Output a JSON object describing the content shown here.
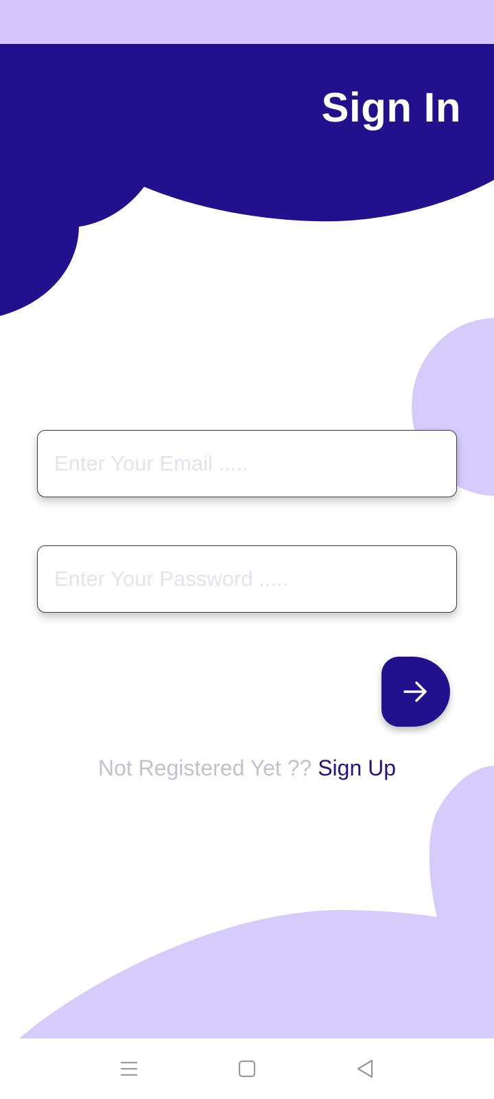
{
  "header": {
    "title": "Sign In"
  },
  "form": {
    "email_placeholder": "Enter Your Email .....",
    "email_value": "",
    "password_placeholder": "Enter Your Password .....",
    "password_value": ""
  },
  "footer": {
    "prompt": "Not Registered Yet ?? ",
    "signup_link": "Sign Up"
  },
  "icons": {
    "submit": "arrow-right-icon",
    "nav_menu": "menu-icon",
    "nav_home": "home-square-icon",
    "nav_back": "back-triangle-icon"
  },
  "colors": {
    "primary": "#22108c",
    "accent_light": "#d6ccfb",
    "status_bar": "#d3c4fb",
    "link": "#23137e",
    "muted_text": "#c3c1cd"
  }
}
